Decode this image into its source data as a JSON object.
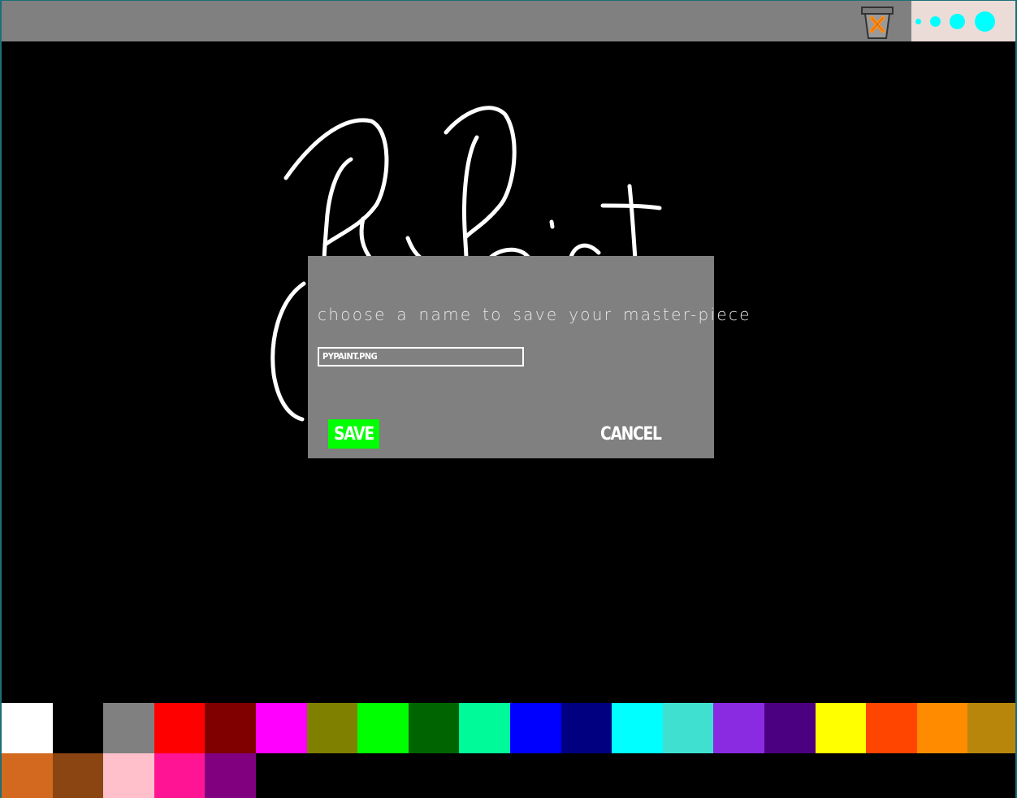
{
  "toolbar": {
    "trash_icon": "trash-can-icon",
    "brush_sizes": [
      "tiny",
      "small",
      "medium",
      "large"
    ],
    "brush_color": "#00ffff"
  },
  "canvas": {
    "background": "#000000",
    "stroke_color": "#ffffff"
  },
  "dialog": {
    "prompt": "choose a name to save your master-piece",
    "filename_value": "pypaint.png",
    "save_label": "SAVE",
    "cancel_label": "CANCEL",
    "save_color": "#00ff00"
  },
  "palette": {
    "colors": [
      "#ffffff",
      "#000000",
      "#808080",
      "#ff0000",
      "#800000",
      "#ff00ff",
      "#808000",
      "#00ff00",
      "#006400",
      "#00fa9a",
      "#0000ff",
      "#000080",
      "#00ffff",
      "#40e0d0",
      "#8a2be2",
      "#4b0082",
      "#ffff00",
      "#ff4500",
      "#ff8c00",
      "#b8860b",
      "#d2691e",
      "#8b4513",
      "#ffc0cb",
      "#ff1493",
      "#800080"
    ]
  }
}
